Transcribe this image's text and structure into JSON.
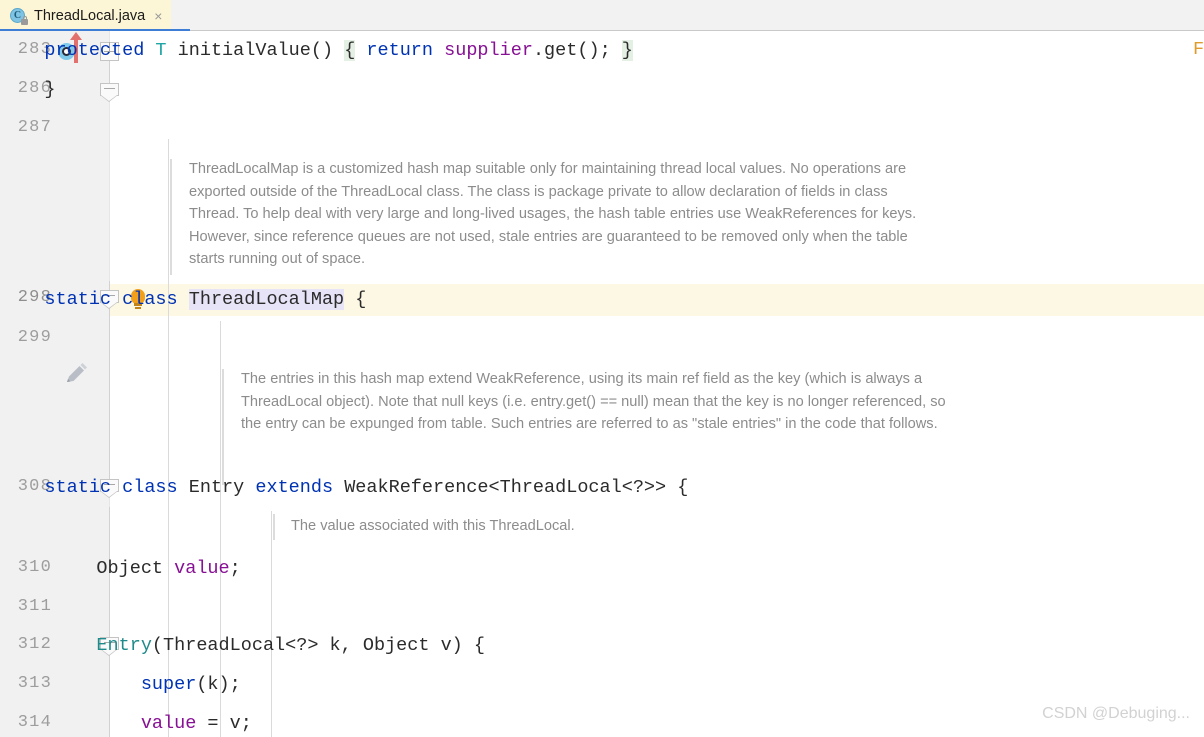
{
  "tab": {
    "title": "ThreadLocal.java",
    "icon": "java-class-icon",
    "close_label": "×"
  },
  "gutter": {
    "override_icon": "override-method-icon",
    "bulb_icon": "intention-bulb-icon",
    "pencil_icon": "pencil-edit-icon",
    "line_numbers": [
      "283",
      "286",
      "287",
      "298",
      "299",
      "308",
      "310",
      "311",
      "312",
      "313",
      "314"
    ]
  },
  "code": {
    "line283": {
      "a": "    protected",
      "b": " T ",
      "c": "initialValue",
      "d": "() ",
      "e": "{",
      "f": " return ",
      "g": "supplier",
      "h": ".get(); ",
      "i": "}"
    },
    "line286": "    }",
    "line298": {
      "a": "    static class ",
      "b": "ThreadLocalMap",
      "c": " {"
    },
    "line308": {
      "a": "    static class ",
      "b": "Entry ",
      "c": "extends ",
      "d": "WeakReference<ThreadLocal<?>> {"
    },
    "line310": {
      "a": "    Object ",
      "b": "value",
      "c": ";"
    },
    "line312": {
      "a": "    Entry",
      "b": "(ThreadLocal<?> k, Object v) {"
    },
    "line313": {
      "a": "        super",
      "b": "(k);"
    },
    "line314": {
      "a": "        value",
      "b": " = v;"
    },
    "right_clip": "F"
  },
  "javadoc": {
    "threadlocalmap": "ThreadLocalMap is a customized hash map suitable only for maintaining thread local values. No operations are exported outside of the ThreadLocal class. The class is package private to allow declaration of fields in class Thread. To help deal with very large and long-lived usages, the hash table entries use WeakReferences for keys. However, since reference queues are not used, stale entries are guaranteed to be removed only when the table starts running out of space.",
    "entry": "The entries in this hash map extend WeakReference, using its main ref field as the key (which is always a ThreadLocal object). Note that null keys (i.e. entry.get() == null) mean that the key is no longer referenced, so the entry can be expunged from table. Such entries are referred to as \"stale entries\" in the code that follows.",
    "value_field": "The value associated with this ThreadLocal."
  },
  "watermark": "CSDN @Debuging..."
}
